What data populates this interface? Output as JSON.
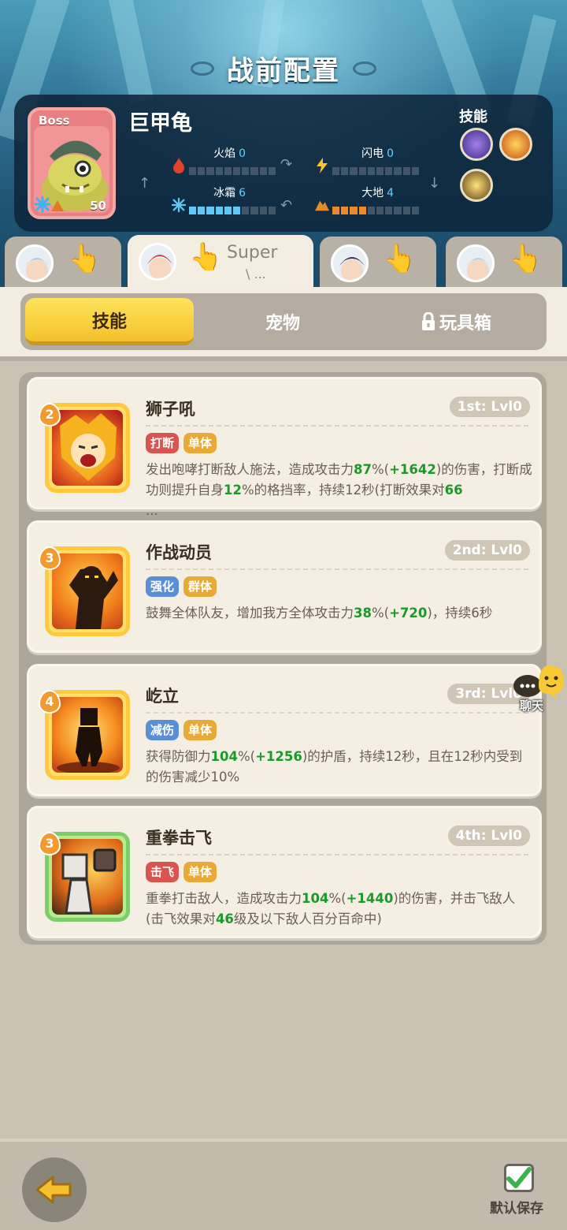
{
  "screen_title": "战前配置",
  "boss": {
    "badge": "Boss",
    "name": "巨甲龟",
    "level": "50",
    "elements": [
      {
        "label": "火焰",
        "value": "0",
        "filled": 0,
        "color": "#e84b2c"
      },
      {
        "label": "闪电",
        "value": "0",
        "filled": 0,
        "color": "#f6c531"
      },
      {
        "label": "冰霜",
        "value": "6",
        "filled": 6,
        "color": "#5fc8f5"
      },
      {
        "label": "大地",
        "value": "4",
        "filled": 4,
        "color": "#e88a2a"
      }
    ],
    "skills_title": "技能"
  },
  "heroes": {
    "tabs": [
      {
        "name": "hero-tab-1",
        "active": false
      },
      {
        "name": "hero-tab-2",
        "active": true,
        "label": "Super",
        "sub": "\\ ..."
      },
      {
        "name": "hero-tab-3",
        "active": false
      },
      {
        "name": "hero-tab-4",
        "active": false
      }
    ]
  },
  "tabs": {
    "skills": "技能",
    "pets": "宠物",
    "toybox": "玩具箱",
    "active": "skills"
  },
  "skills": [
    {
      "rank": "2",
      "name": "狮子吼",
      "slot": "1st: Lvl0",
      "tags": [
        {
          "text": "打断",
          "color": "red"
        },
        {
          "text": "单体",
          "color": "gold"
        }
      ],
      "desc_parts": [
        {
          "t": "发出咆哮打断敌人施法，造成攻击力"
        },
        {
          "t": "87",
          "hl": true
        },
        {
          "t": "%("
        },
        {
          "t": "+1642",
          "hl": true
        },
        {
          "t": ")的伤害，打断成功则提升自身"
        },
        {
          "t": "12",
          "hl": true
        },
        {
          "t": "%的格挡率，持续12秒(打断效果对"
        },
        {
          "t": "66",
          "hl": true
        },
        {
          "t": "\n..."
        }
      ]
    },
    {
      "rank": "3",
      "name": "作战动员",
      "slot": "2nd: Lvl0",
      "tags": [
        {
          "text": "强化",
          "color": "blue"
        },
        {
          "text": "群体",
          "color": "gold"
        }
      ],
      "desc_parts": [
        {
          "t": "鼓舞全体队友，增加我方全体攻击力"
        },
        {
          "t": "38",
          "hl": true
        },
        {
          "t": "%("
        },
        {
          "t": "+720",
          "hl": true
        },
        {
          "t": ")，持续6秒"
        }
      ]
    },
    {
      "rank": "4",
      "name": "屹立",
      "slot": "3rd: Lvl0",
      "tags": [
        {
          "text": "减伤",
          "color": "blue"
        },
        {
          "text": "单体",
          "color": "gold"
        }
      ],
      "desc_parts": [
        {
          "t": "获得防御力"
        },
        {
          "t": "104",
          "hl": true
        },
        {
          "t": "%("
        },
        {
          "t": "+1256",
          "hl": true
        },
        {
          "t": ")的护盾，持续12秒，且在12秒内受到的伤害减少10%"
        }
      ]
    },
    {
      "rank": "3",
      "name": "重拳击飞",
      "slot": "4th: Lvl0",
      "tags": [
        {
          "text": "击飞",
          "color": "red"
        },
        {
          "text": "单体",
          "color": "gold"
        }
      ],
      "desc_parts": [
        {
          "t": "重拳打击敌人，造成攻击力"
        },
        {
          "t": "104",
          "hl": true
        },
        {
          "t": "%("
        },
        {
          "t": "+1440",
          "hl": true
        },
        {
          "t": ")的伤害，并击飞敌人(击飞效果对"
        },
        {
          "t": "46",
          "hl": true
        },
        {
          "t": "级及以下敌人百分百命中)"
        }
      ]
    }
  ],
  "chat": {
    "label": "聊天"
  },
  "footer": {
    "save_label": "默认保存",
    "back": "back"
  }
}
